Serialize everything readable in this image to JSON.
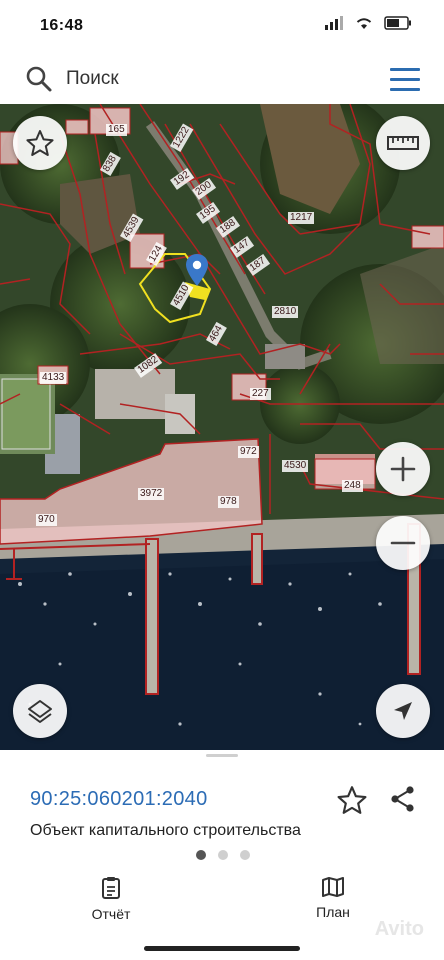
{
  "status_bar": {
    "time": "16:48",
    "signal": "▂▄▆",
    "wifi": "wifi",
    "battery": "battery"
  },
  "search": {
    "placeholder": "Поиск"
  },
  "map": {
    "parcels": [
      {
        "id": "p165",
        "label": "165"
      },
      {
        "id": "p1222",
        "label": "1222"
      },
      {
        "id": "p838",
        "label": "838"
      },
      {
        "id": "p192",
        "label": "192"
      },
      {
        "id": "p200",
        "label": "200"
      },
      {
        "id": "p195",
        "label": "195"
      },
      {
        "id": "p188",
        "label": "188"
      },
      {
        "id": "p147",
        "label": "147"
      },
      {
        "id": "p187",
        "label": "187"
      },
      {
        "id": "p1217",
        "label": "1217"
      },
      {
        "id": "p4539",
        "label": "4539"
      },
      {
        "id": "p124",
        "label": "124"
      },
      {
        "id": "p4510",
        "label": "4510"
      },
      {
        "id": "p464",
        "label": "464"
      },
      {
        "id": "p2810",
        "label": "2810"
      },
      {
        "id": "p1082",
        "label": "1082"
      },
      {
        "id": "p4133",
        "label": "4133"
      },
      {
        "id": "p227",
        "label": "227"
      },
      {
        "id": "p972",
        "label": "972"
      },
      {
        "id": "p4530",
        "label": "4530"
      },
      {
        "id": "p248",
        "label": "248"
      },
      {
        "id": "p3972",
        "label": "3972"
      },
      {
        "id": "p978",
        "label": "978"
      },
      {
        "id": "p970",
        "label": "970"
      }
    ]
  },
  "sheet": {
    "cadastral_number": "90:25:060201:2040",
    "object_type": "Объект капитального строительства",
    "tabs": [
      {
        "label": "Отчёт",
        "icon": "report-icon"
      },
      {
        "label": "План",
        "icon": "map-plan-icon"
      }
    ],
    "watermark": "Avito"
  },
  "colors": {
    "accent": "#2c6cb5",
    "parcel_border": "#b22222",
    "parcel_fill": "#f4c7c7",
    "selected": "#f0e020"
  }
}
